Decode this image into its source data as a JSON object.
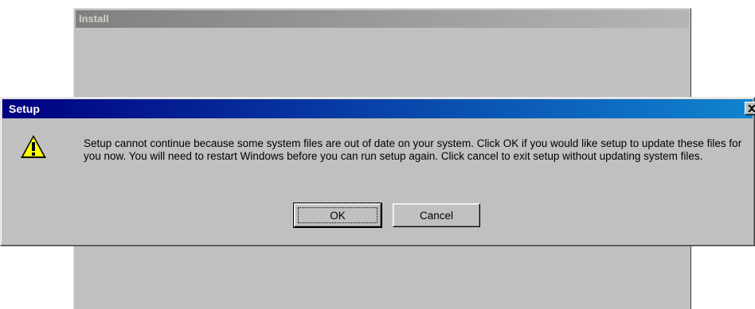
{
  "install_window": {
    "title": "Install"
  },
  "dialog": {
    "title": "Setup",
    "icon": "warning-icon",
    "message": "Setup cannot continue because some system files are out of date on your system.  Click OK if you would like setup to update these files for you now.  You will need to restart Windows before you can run setup again.  Click cancel to exit setup without updating system files.",
    "buttons": {
      "ok_label": "OK",
      "cancel_label": "Cancel"
    }
  }
}
